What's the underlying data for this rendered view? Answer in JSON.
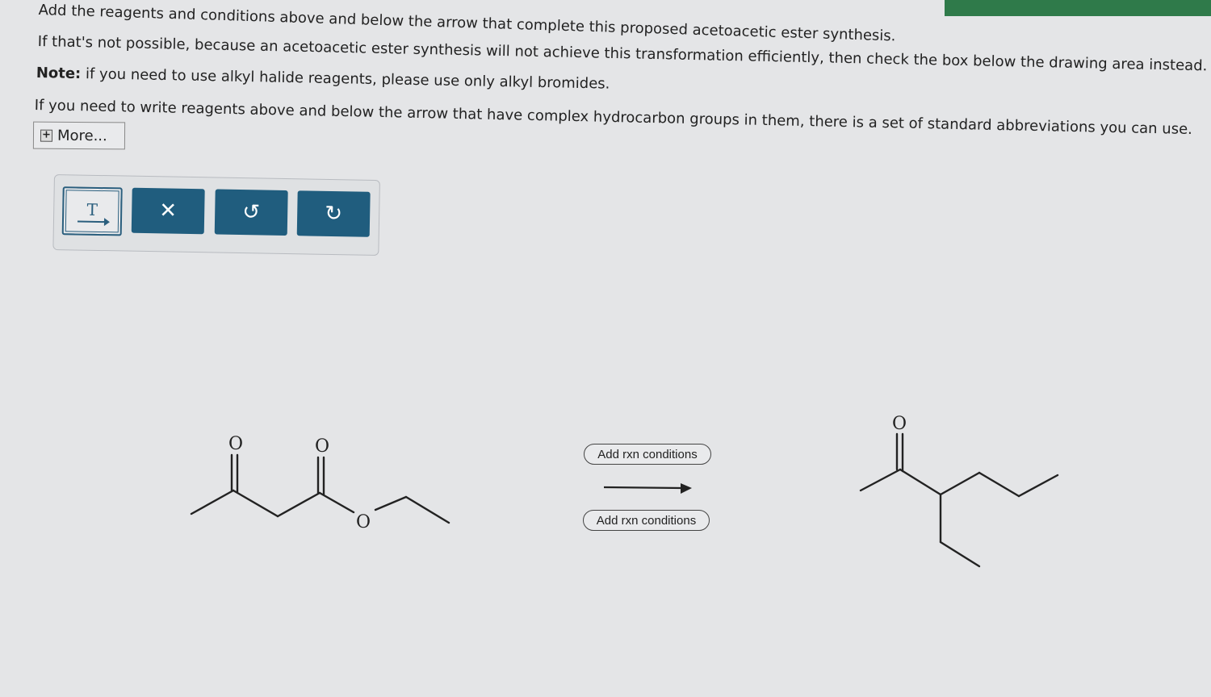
{
  "instructions": {
    "line1": "Add the reagents and conditions above and below the arrow that complete this proposed acetoacetic ester synthesis.",
    "line2": "If that's not possible, because an acetoacetic ester synthesis will not achieve this transformation efficiently, then check the box below the drawing area instead.",
    "note_label": "Note:",
    "note_text": " if you need to use alkyl halide reagents, please use only alkyl bromides.",
    "line4": "If you need to write reagents above and below the arrow that have complex hydrocarbon groups in them, there is a set of standard abbreviations you can use."
  },
  "more_button": {
    "label": "More..."
  },
  "toolbar": {
    "text_tool": {
      "label": "T",
      "icon": "text-arrow-icon"
    },
    "clear": {
      "glyph": "✕",
      "icon": "close-icon"
    },
    "undo": {
      "glyph": "↺",
      "icon": "undo-icon"
    },
    "redo": {
      "glyph": "↻",
      "icon": "redo-icon"
    }
  },
  "reaction": {
    "above_arrow": "Add rxn conditions",
    "below_arrow": "Add rxn conditions"
  },
  "molecules": {
    "reactant_atom_labels": [
      "O",
      "O",
      "O"
    ],
    "product_atom_labels": [
      "O"
    ]
  }
}
